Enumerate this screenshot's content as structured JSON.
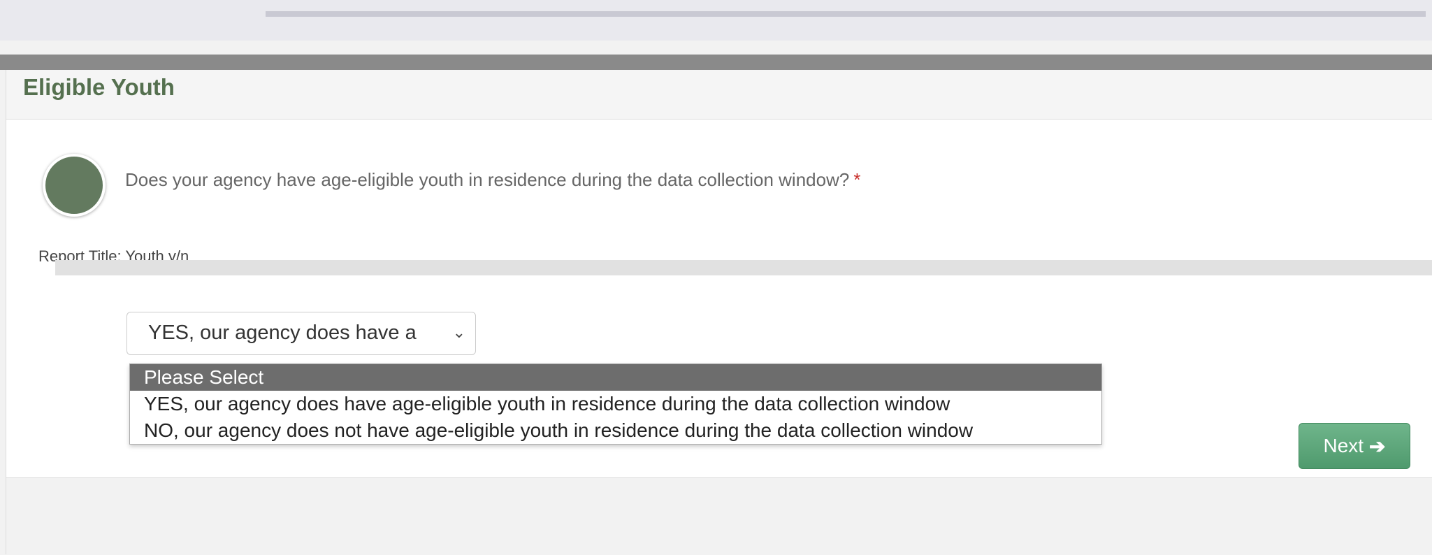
{
  "panel": {
    "title": "Eligible Youth"
  },
  "question": {
    "text": "Does your agency have age-eligible youth in residence during the data collection window?",
    "required_marker": "*"
  },
  "report": {
    "label": "Report Title: Youth y/n"
  },
  "select": {
    "current_value": "YES, our agency does have a",
    "options": [
      "Please Select",
      "YES, our agency does have age-eligible youth in residence during the data collection window",
      "NO, our agency does not have age-eligible youth in residence during the data collection window"
    ],
    "highlighted_index": 0
  },
  "footer": {
    "next_label": "Next",
    "next_icon": "arrow-right-icon"
  },
  "colors": {
    "title_green": "#55704f",
    "step_circle": "#637a5f",
    "next_button": "#5aa77b"
  }
}
